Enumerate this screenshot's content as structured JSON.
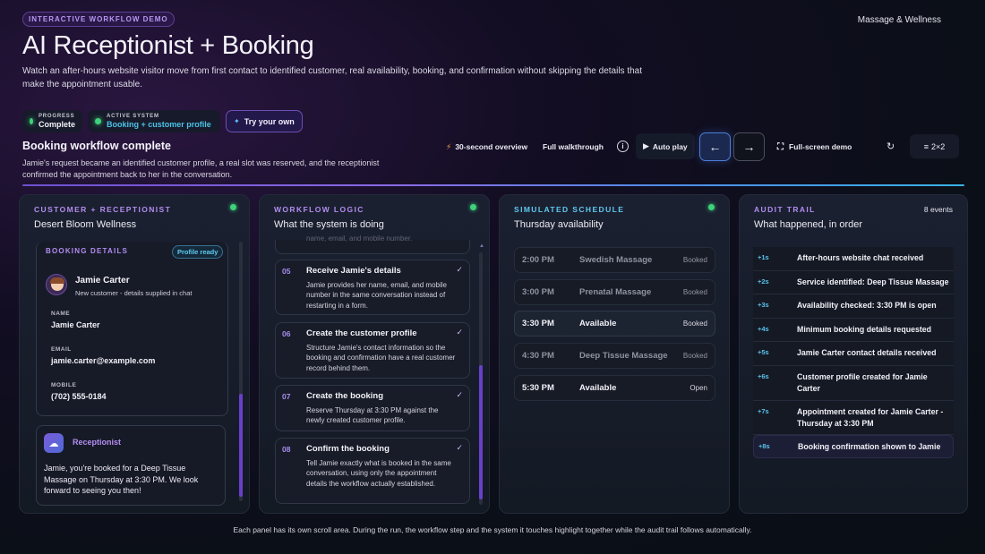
{
  "header": {
    "demo_pill": "INTERACTIVE WORKFLOW DEMO",
    "brand": "Massage & Wellness",
    "title": "AI Receptionist + Booking",
    "subtitle": "Watch an after-hours website visitor move from first contact to identified customer, real availability, booking, and confirmation without skipping the details that make the appointment usable."
  },
  "status": {
    "progress_label": "PROGRESS",
    "progress_value": "Complete",
    "system_label": "ACTIVE SYSTEM",
    "system_value": "Booking + customer profile",
    "try_label": "Try your own"
  },
  "workflow": {
    "title": "Booking workflow complete",
    "description": "Jamie's request became an identified customer profile, a real slot was reserved, and the receptionist confirmed the appointment back to her in the conversation."
  },
  "controls": {
    "overview": "30-second overview",
    "walkthrough": "Full walkthrough",
    "info": "i",
    "autoplay": "Auto play",
    "prev": "←",
    "next": "→",
    "fullscreen": "Full-screen demo",
    "refresh": "↻",
    "grid": "2×2"
  },
  "colors": {
    "purple_accent": "#b28df0",
    "cyan_accent": "#4cc3e8",
    "green_status": "#3ed27a"
  },
  "panels": {
    "customer": {
      "heading": "CUSTOMER + RECEPTIONIST",
      "subheading": "Desert Bloom Wellness",
      "booking_heading": "BOOKING DETAILS",
      "badge": "Profile ready",
      "name": "Jamie Carter",
      "note": "New customer - details supplied in chat",
      "fields": [
        {
          "label": "NAME",
          "value": "Jamie Carter"
        },
        {
          "label": "EMAIL",
          "value": "jamie.carter@example.com"
        },
        {
          "label": "MOBILE",
          "value": "(702) 555-0184"
        }
      ],
      "receptionist_label": "Receptionist",
      "receptionist_message": "Jamie, you're booked for a Deep Tissue Massage on Thursday at 3:30 PM. We look forward to seeing you then!"
    },
    "logic": {
      "heading": "WORKFLOW LOGIC",
      "subheading": "What the system is doing",
      "partial_text": "name, email, and mobile number.",
      "steps": [
        {
          "num": "05",
          "title": "Receive Jamie's details",
          "desc": "Jamie provides her name, email, and mobile number in the same conversation instead of restarting in a form.",
          "check": "✓"
        },
        {
          "num": "06",
          "title": "Create the customer profile",
          "desc": "Structure Jamie's contact information so the booking and confirmation have a real customer record behind them.",
          "check": "✓"
        },
        {
          "num": "07",
          "title": "Create the booking",
          "desc": "Reserve Thursday at 3:30 PM against the newly created customer profile.",
          "check": "✓"
        },
        {
          "num": "08",
          "title": "Confirm the booking",
          "desc": "Tell Jamie exactly what is booked in the same conversation, using only the appointment details the workflow actually established.",
          "check": "✓"
        }
      ]
    },
    "schedule": {
      "heading": "SIMULATED SCHEDULE",
      "subheading": "Thursday availability",
      "slots": [
        {
          "time": "2:00 PM",
          "service": "Swedish Massage",
          "status": "Booked"
        },
        {
          "time": "3:00 PM",
          "service": "Prenatal Massage",
          "status": "Booked"
        },
        {
          "time": "3:30 PM",
          "service": "Available",
          "status": "Booked"
        },
        {
          "time": "4:30 PM",
          "service": "Deep Tissue Massage",
          "status": "Booked"
        },
        {
          "time": "5:30 PM",
          "service": "Available",
          "status": "Open"
        }
      ]
    },
    "audit": {
      "heading": "AUDIT TRAIL",
      "subheading": "What happened, in order",
      "count": "8 events",
      "events": [
        {
          "t": "+1s",
          "e": "After-hours website chat received"
        },
        {
          "t": "+2s",
          "e": "Service identified: Deep Tissue Massage"
        },
        {
          "t": "+3s",
          "e": "Availability checked: 3:30 PM is open"
        },
        {
          "t": "+4s",
          "e": "Minimum booking details requested"
        },
        {
          "t": "+5s",
          "e": "Jamie Carter contact details received"
        },
        {
          "t": "+6s",
          "e": "Customer profile created for Jamie Carter"
        },
        {
          "t": "+7s",
          "e": "Appointment created for Jamie Carter - Thursday at 3:30 PM"
        },
        {
          "t": "+8s",
          "e": "Booking confirmation shown to Jamie"
        }
      ]
    }
  },
  "footer": "Each panel has its own scroll area. During the run, the workflow step and the system it touches highlight together while the audit trail follows automatically."
}
